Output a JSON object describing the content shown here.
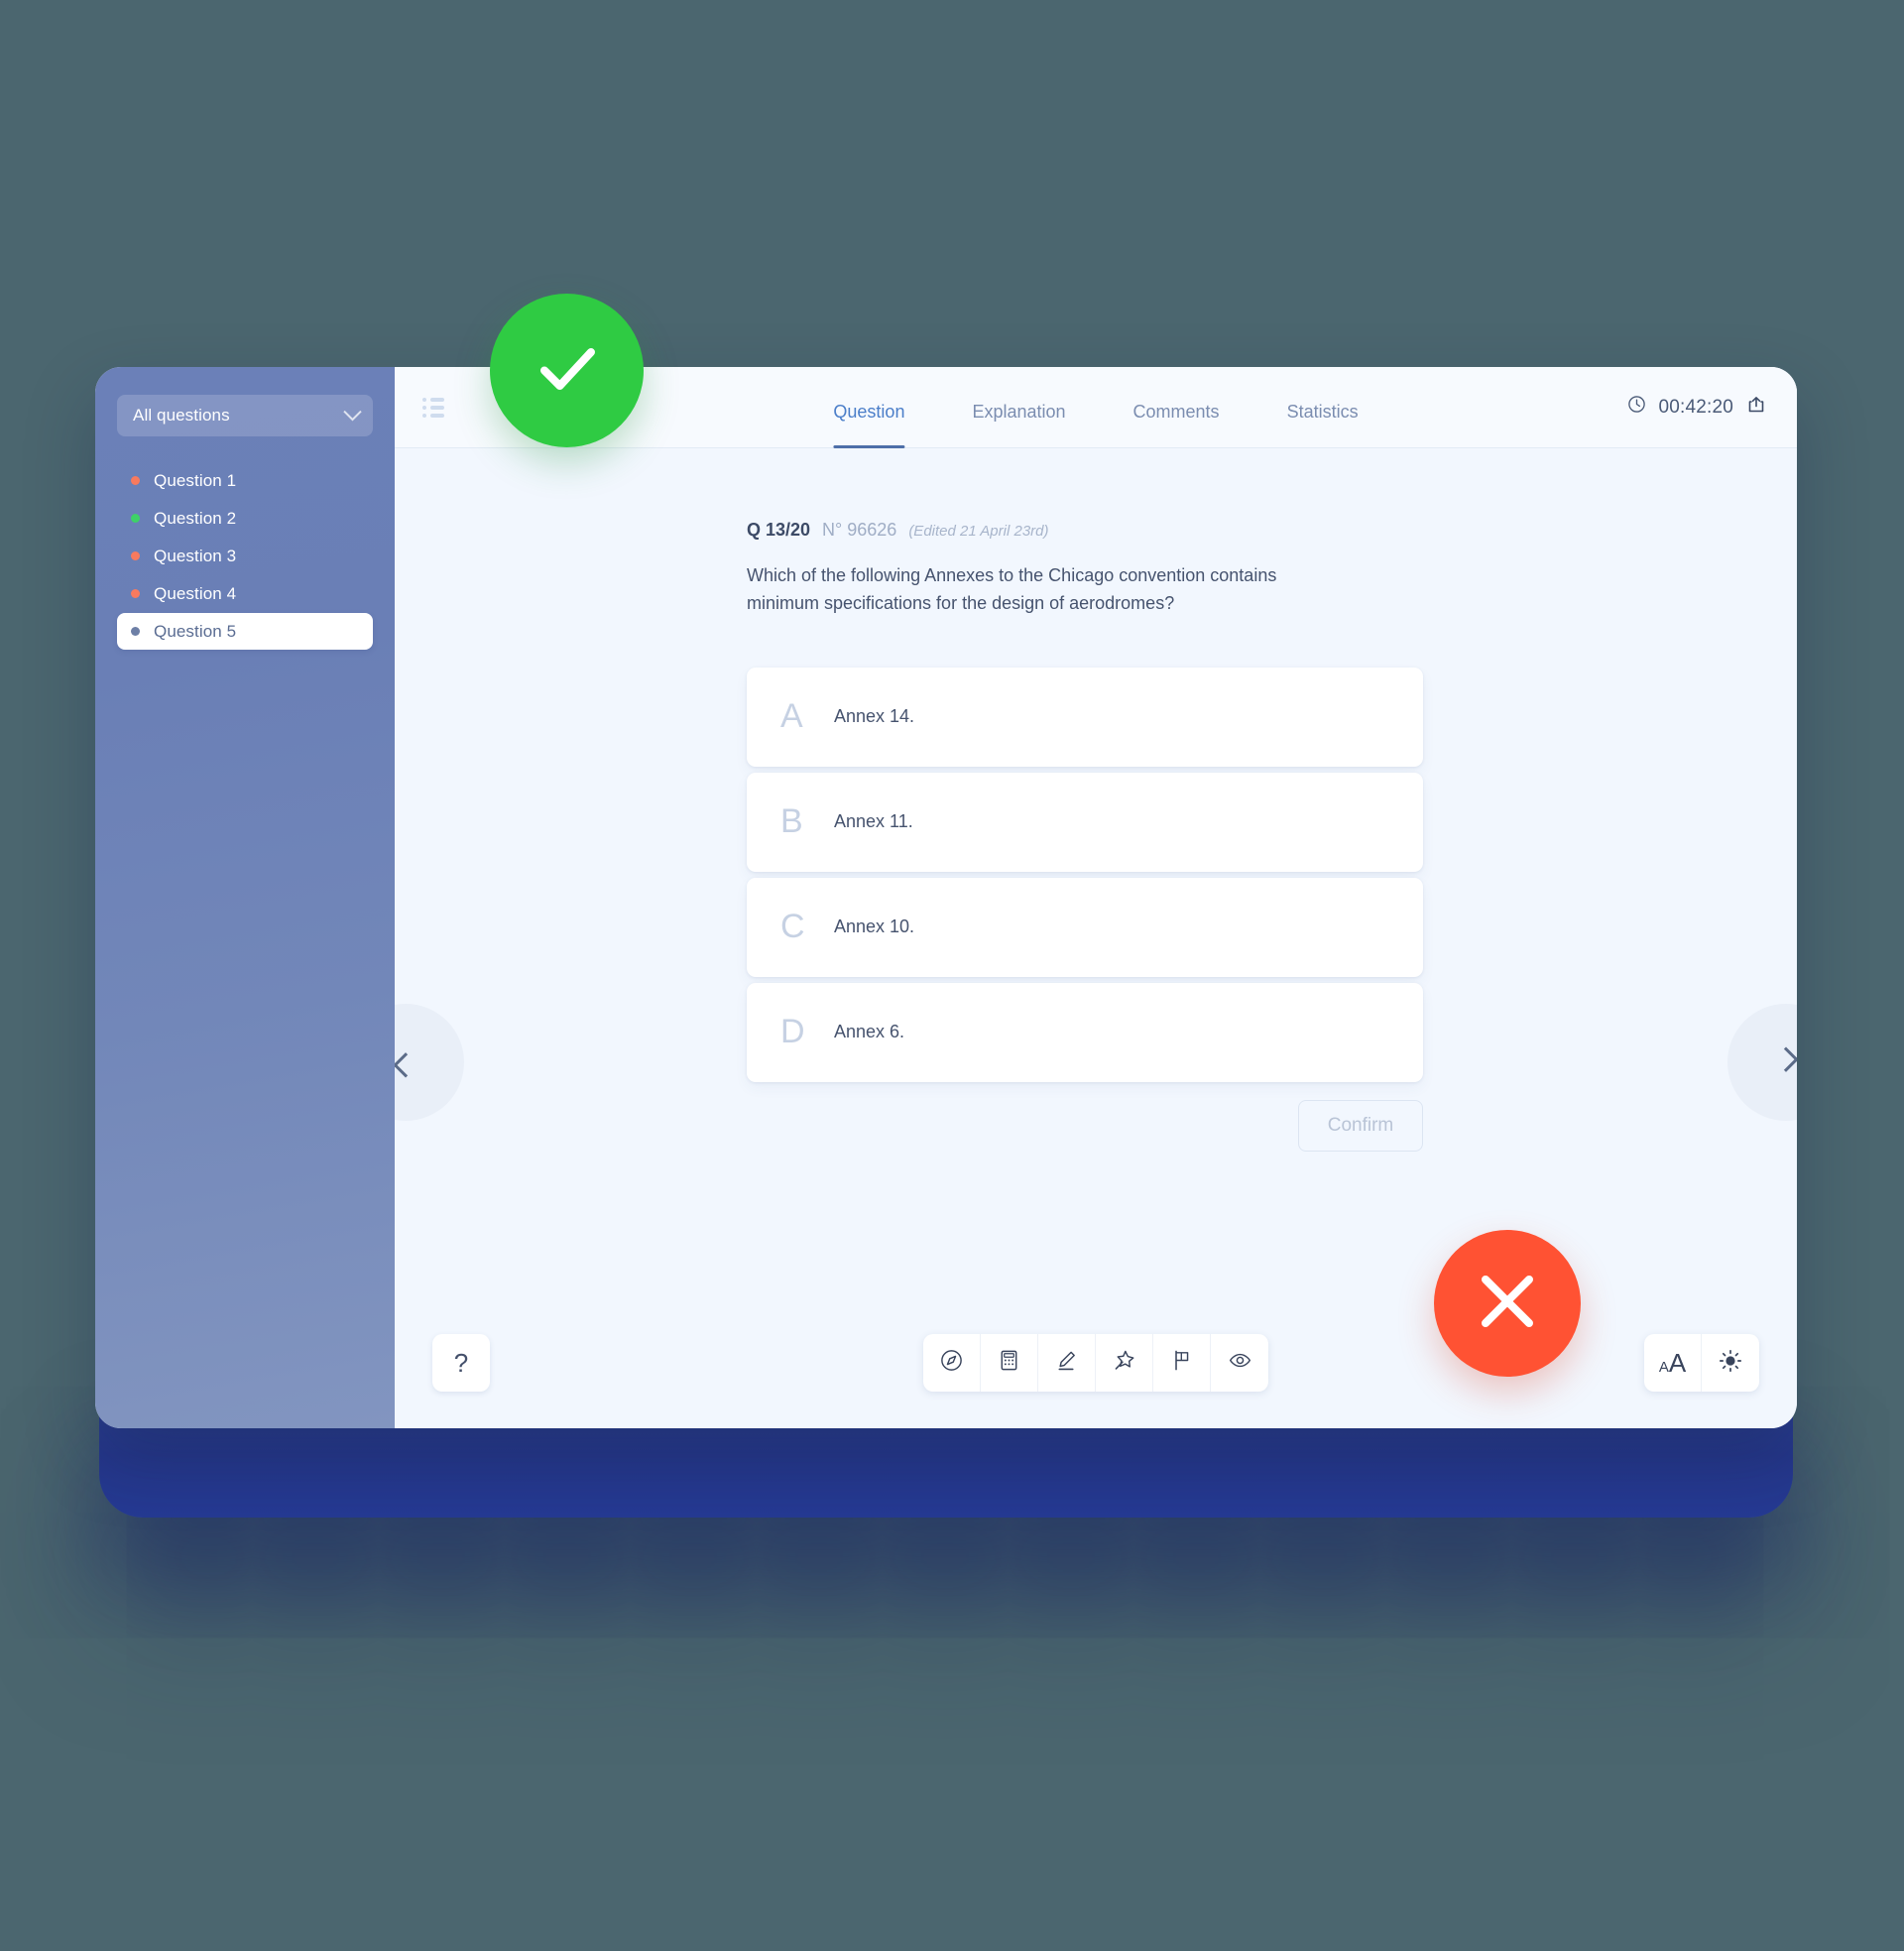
{
  "sidebar": {
    "filter": {
      "label": "All questions",
      "icon": "chevron-down-icon"
    },
    "items": [
      {
        "label": "Question 1",
        "status_color": "#f87a5e",
        "active": false
      },
      {
        "label": "Question 2",
        "status_color": "#3ed167",
        "active": false
      },
      {
        "label": "Question 3",
        "status_color": "#f87a5e",
        "active": false
      },
      {
        "label": "Question 4",
        "status_color": "#f87a5e",
        "active": false
      },
      {
        "label": "Question 5",
        "status_color": "#6d7fa6",
        "active": true
      }
    ]
  },
  "topbar": {
    "list_icon": "list-icon",
    "tabs": [
      {
        "label": "Question",
        "active": true
      },
      {
        "label": "Explanation",
        "active": false
      },
      {
        "label": "Comments",
        "active": false
      },
      {
        "label": "Statistics",
        "active": false
      }
    ],
    "timer": "00:42:20",
    "clock_icon": "clock-icon",
    "share_icon": "share-icon"
  },
  "question": {
    "number": "Q 13/20",
    "id": "N° 96626",
    "edited": "(Edited 21 April 23rd)",
    "text": "Which of the following Annexes to the Chicago convention contains minimum specifications for the design of aerodromes?",
    "answers": [
      {
        "letter": "A",
        "text": "Annex 14."
      },
      {
        "letter": "B",
        "text": "Annex 11."
      },
      {
        "letter": "C",
        "text": "Annex 10."
      },
      {
        "letter": "D",
        "text": "Annex 6."
      }
    ],
    "confirm_label": "Confirm"
  },
  "navigation": {
    "prev_icon": "chevron-left-icon",
    "next_icon": "chevron-right-icon"
  },
  "bottom": {
    "help_label": "?",
    "tools": [
      {
        "name": "compass-icon"
      },
      {
        "name": "calculator-icon"
      },
      {
        "name": "highlighter-pen-icon"
      },
      {
        "name": "pin-icon"
      },
      {
        "name": "flag-icon"
      },
      {
        "name": "eye-icon"
      }
    ],
    "font_size_small": "A",
    "font_size_large": "A",
    "brightness_icon": "sun-icon"
  },
  "badges": {
    "correct": {
      "icon": "check-icon",
      "color": "#2fcb43"
    },
    "incorrect": {
      "icon": "cross-icon",
      "color": "#ff5233"
    }
  }
}
